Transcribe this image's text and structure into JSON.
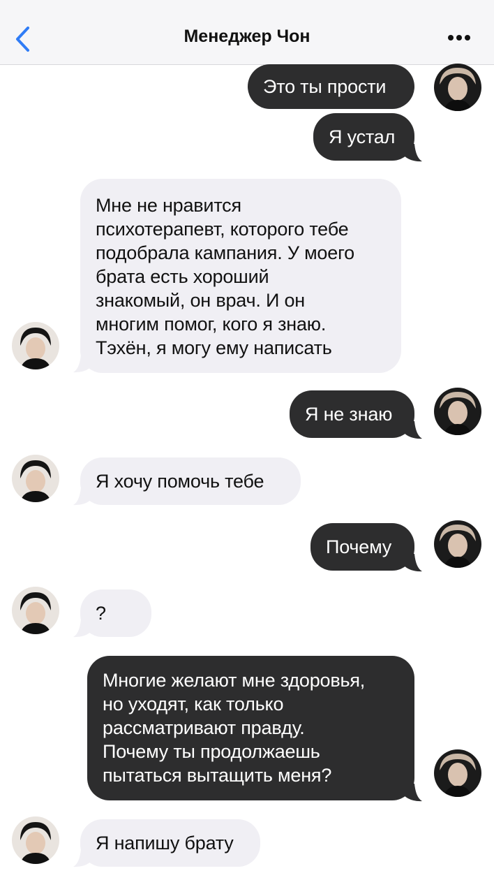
{
  "header": {
    "title": "Менеджер Чон",
    "back_icon": "chevron-left-icon",
    "more_icon": "more-dots-icon",
    "accent": "#2f7cf6"
  },
  "colors": {
    "outgoing": "#2d2d2e",
    "incoming": "#f0eff4"
  },
  "messages": [
    {
      "side": "out",
      "text": "Это ты прости"
    },
    {
      "side": "out",
      "text": "Я устал"
    },
    {
      "side": "in",
      "text": "Мне не нравится\nпсихотерапевт, которого тебе\nподобрала кампания. У моего\nбрата есть хороший\nзнакомый, он врач. И он\nмногим помог, кого я знаю.\nТэхён, я могу ему написать"
    },
    {
      "side": "out",
      "text": "Я не знаю"
    },
    {
      "side": "in",
      "text": "Я хочу помочь тебе"
    },
    {
      "side": "out",
      "text": "Почему"
    },
    {
      "side": "in",
      "text": "?"
    },
    {
      "side": "out",
      "text": "Многие желают мне здоровья,\nно уходят, как только\nрассматривают правду.\nПочему ты продолжаешь\nпытаться вытащить меня?"
    },
    {
      "side": "in",
      "text": "Я напишу брату"
    }
  ]
}
